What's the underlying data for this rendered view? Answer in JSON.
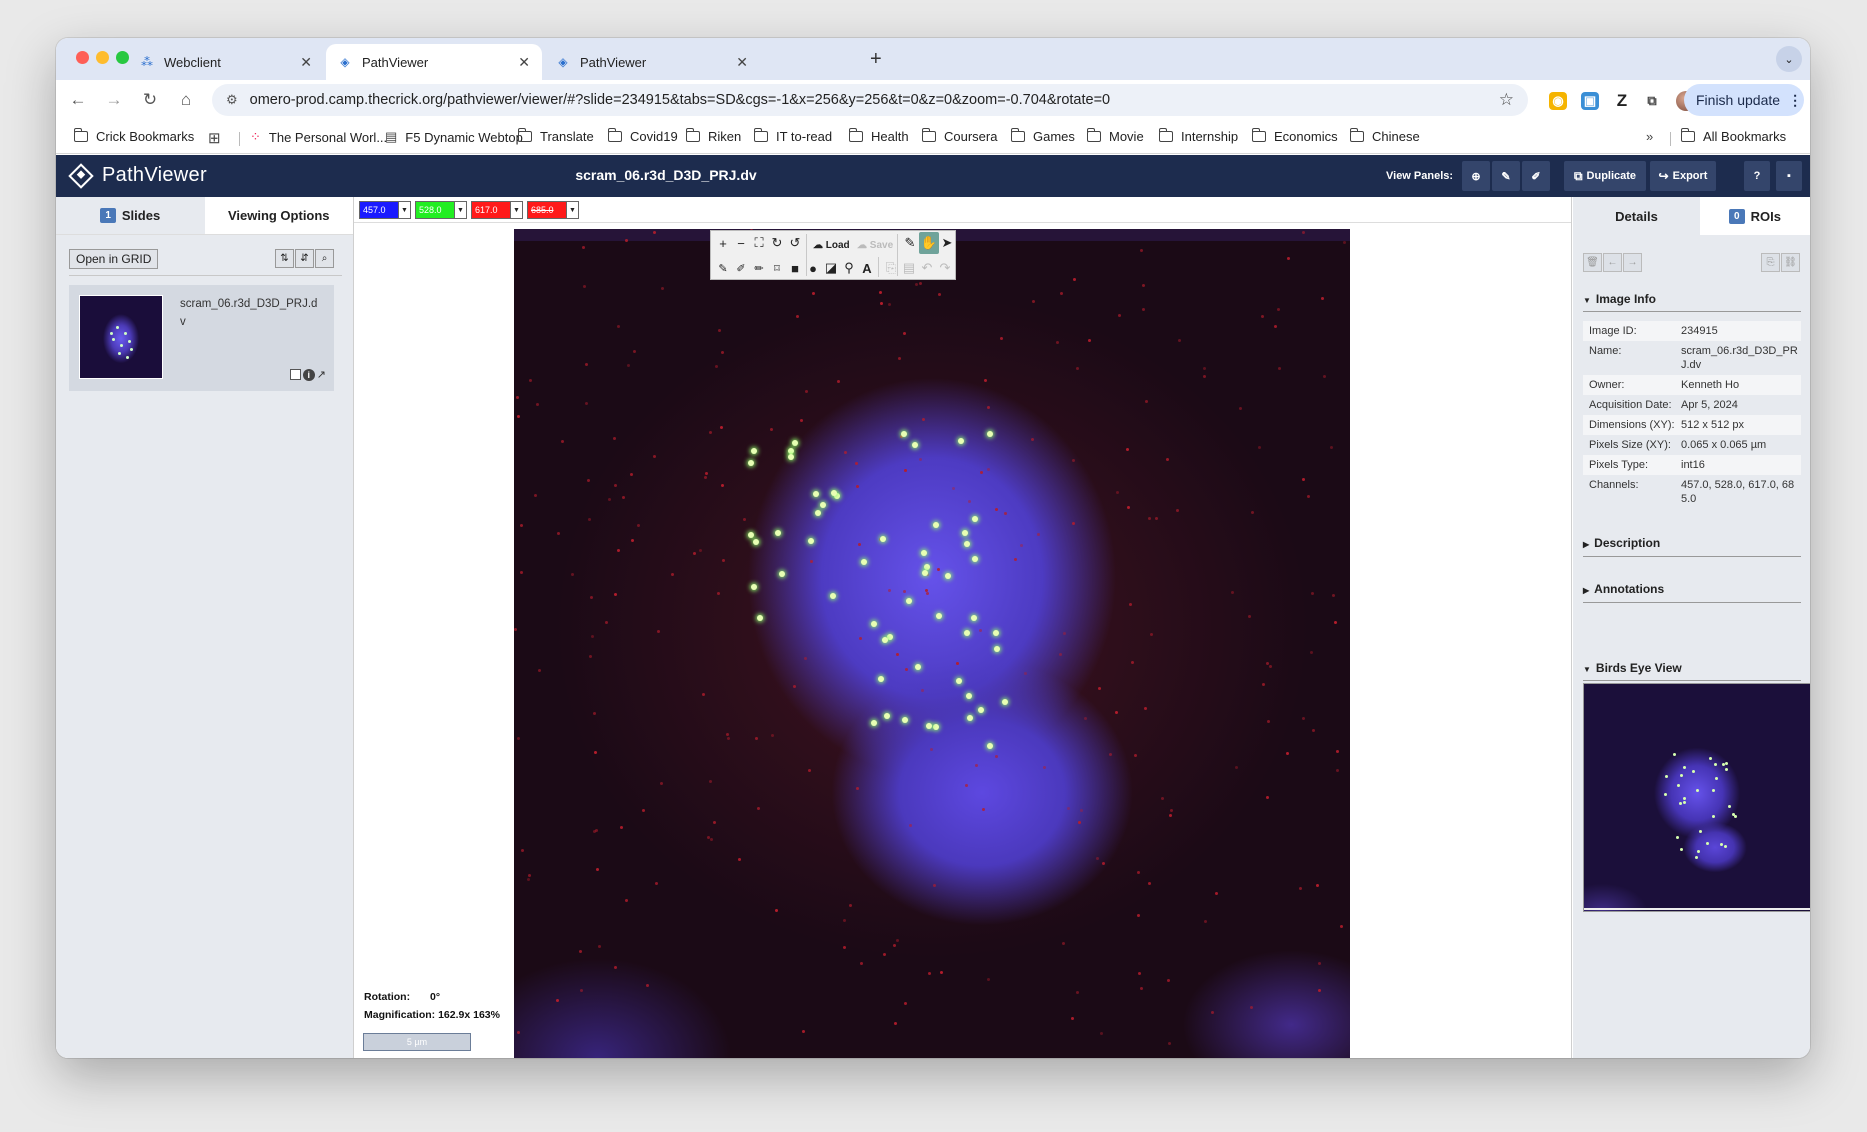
{
  "browser": {
    "tabs": [
      {
        "title": "Webclient",
        "icon": "omero-icon"
      },
      {
        "title": "PathViewer",
        "icon": "pathviewer-icon"
      },
      {
        "title": "PathViewer",
        "icon": "pathviewer-icon"
      }
    ],
    "active_tab": 1,
    "url": "omero-prod.camp.thecrick.org/pathviewer/viewer/#?slide=234915&tabs=SD&cgs=-1&x=256&y=256&t=0&z=0&zoom=-0.704&rotate=0",
    "finish_update": "Finish update",
    "bookmarks": [
      "Crick Bookmarks",
      "The Personal Worl...",
      "F5 Dynamic Webtop",
      "Translate",
      "Covid19",
      "Riken",
      "IT to-read",
      "Health",
      "Coursera",
      "Games",
      "Movie",
      "Internship",
      "Economics",
      "Chinese"
    ],
    "all_bookmarks": "All Bookmarks"
  },
  "app": {
    "name": "PathViewer",
    "title": "scram_06.r3d_D3D_PRJ.dv",
    "view_panels_label": "View Panels:",
    "duplicate_label": "Duplicate",
    "export_label": "Export",
    "help_label": "?"
  },
  "left": {
    "slides_count": "1",
    "slides_tab": "Slides",
    "viewing_tab": "Viewing Options",
    "open_grid": "Open in GRID",
    "slide_name": "scram_06.r3d_D3D_PRJ.dv"
  },
  "viewer": {
    "channels": [
      {
        "label": "457.0",
        "color": "#1a1aff",
        "active": true
      },
      {
        "label": "528.0",
        "color": "#22ee22",
        "active": true
      },
      {
        "label": "617.0",
        "color": "#ff1a1a",
        "active": true
      },
      {
        "label": "685.0",
        "color": "#ff1a1a",
        "active": false
      }
    ],
    "toolbar": {
      "load": "Load",
      "save": "Save"
    },
    "rotation_label": "Rotation:",
    "rotation_value": "0°",
    "magnification_label": "Magnification:",
    "magnification_value": "162.9x 163%",
    "scalebar": "5 µm"
  },
  "right": {
    "details_tab": "Details",
    "rois_count": "0",
    "rois_tab": "ROIs",
    "image_info_title": "Image Info",
    "image_info": [
      {
        "key": "Image ID:",
        "value": "234915"
      },
      {
        "key": "Name:",
        "value": "scram_06.r3d_D3D_PRJ.dv"
      },
      {
        "key": "Owner:",
        "value": "Kenneth Ho"
      },
      {
        "key": "Acquisition Date:",
        "value": "Apr 5, 2024"
      },
      {
        "key": "Dimensions (XY):",
        "value": "512 x 512 px"
      },
      {
        "key": "Pixels Size (XY):",
        "value": "0.065 x 0.065 µm"
      },
      {
        "key": "Pixels Type:",
        "value": "int16"
      },
      {
        "key": "Channels:",
        "value": "457.0, 528.0, 617.0, 685.0"
      }
    ],
    "description_title": "Description",
    "annotations_title": "Annotations",
    "birds_eye_title": "Birds Eye View"
  },
  "colors": {
    "header_bg": "#1d2c4e",
    "accent": "#4a78b8",
    "panel_bg": "#e7eaef"
  }
}
